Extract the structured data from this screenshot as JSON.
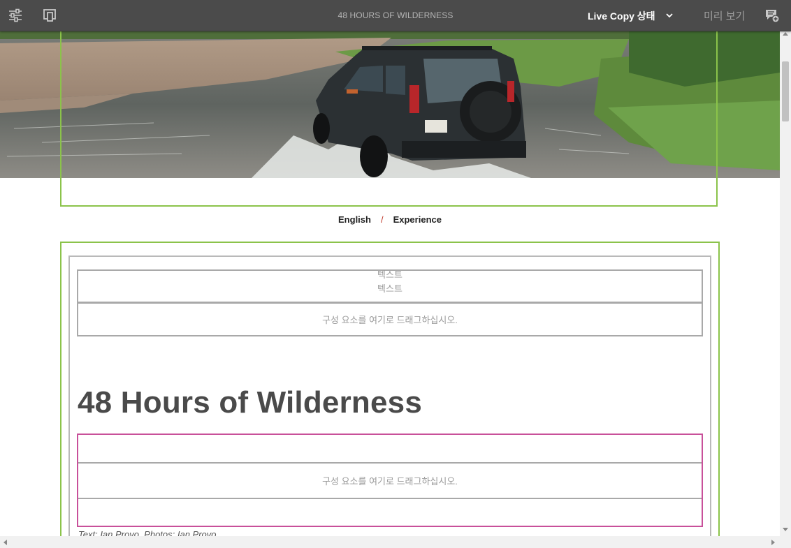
{
  "toolbar": {
    "page_title": "48 HOURS OF WILDERNESS",
    "live_copy_label": "Live Copy 상태",
    "preview_label": "미리 보기",
    "icons": [
      "page-properties-icon",
      "emulator-icon",
      "chevron-down-icon",
      "annotations-icon"
    ]
  },
  "breadcrumb": {
    "items": [
      "English",
      "Experience"
    ],
    "separator": "/"
  },
  "editor": {
    "text_component_label_1": "텍스트",
    "text_component_label_2": "텍스트",
    "drop_zone_label": "구성 요소를 여기로 드래그하십시오.",
    "article_title": "48 Hours of Wilderness",
    "drop_zone_label_2": "구성 요소를 여기로 드래그하십시오.",
    "credit_text": "Text: Ian Provo, Photos: Ian Provo"
  },
  "colors": {
    "toolbar_bg": "#4b4b4b",
    "live_copy_frame": "#8bc34a",
    "selected_component_frame": "#c8509a",
    "breadcrumb_separator": "#c0392b"
  }
}
